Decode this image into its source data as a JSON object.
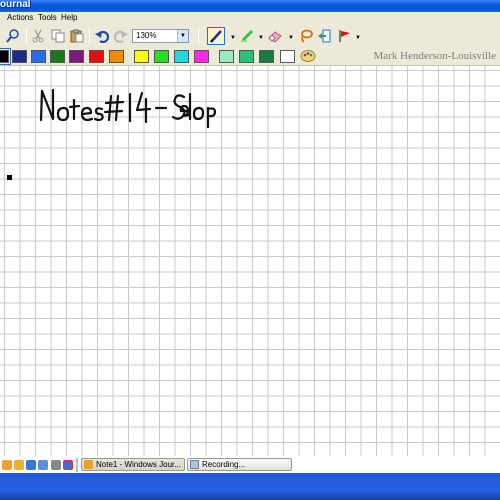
{
  "window": {
    "title": "ournal"
  },
  "menu": {
    "items": [
      "Actions",
      "Tools",
      "Help"
    ]
  },
  "toolbar": {
    "zoom_value": "130%",
    "icons": [
      "search-icon",
      "cut-icon",
      "copy-icon",
      "paste-icon",
      "undo-icon",
      "redo-icon",
      "pen-icon",
      "highlighter-icon",
      "eraser-icon",
      "lasso-icon",
      "insert-space-icon",
      "flag-icon"
    ]
  },
  "palette": {
    "colors": [
      "#000000",
      "#1f2a8a",
      "#2a6cf0",
      "#1a7a1a",
      "#7a1a7a",
      "#e01010",
      "#f08c00",
      "#ffff00",
      "#22e022",
      "#22d8e0",
      "#ff2adf",
      "#9be9c0",
      "#2bc07a",
      "#1a7a40",
      "#ffffff"
    ],
    "selected_index": 0
  },
  "watermark": "Mark Henderson-Louisville",
  "canvas": {
    "ink_text": "Notes #14 - Slope"
  },
  "taskbar": {
    "buttons": [
      {
        "label": "Note1 - Windows Jour...",
        "active": true
      },
      {
        "label": "Recording...",
        "active": false
      }
    ]
  }
}
